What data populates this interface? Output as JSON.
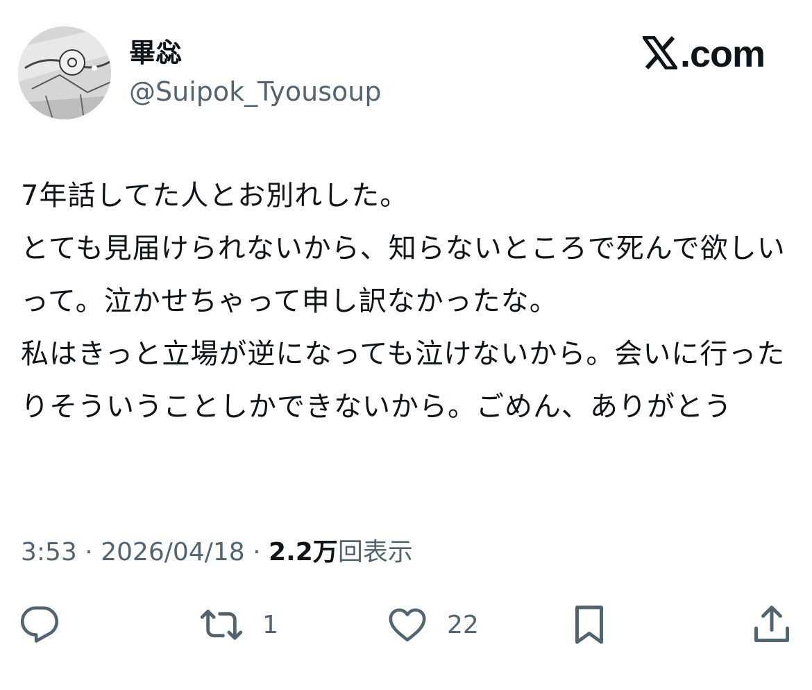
{
  "post": {
    "author": {
      "display_name": "畢惢",
      "handle": "@Suipok_Tyousoup"
    },
    "brand": {
      "text": ".com",
      "icon": "x-logo-icon"
    },
    "text": "7年話してた人とお別れした。\nとても見届けられないから、知らないところで死んで欲しいって。泣かせちゃって申し訳なかったな。\n私はきっと立場が逆になっても泣けないから。会いに行ったりそういうことしかできないから。ごめん、ありがとう",
    "meta": {
      "time": "3:53",
      "separator": " · ",
      "date": "2026/04/18",
      "views_count": "2.2万",
      "views_label": "回表示"
    },
    "actions": {
      "reply": {
        "icon": "reply-icon",
        "count": ""
      },
      "repost": {
        "icon": "repost-icon",
        "count": "1"
      },
      "like": {
        "icon": "heart-icon",
        "count": "22"
      },
      "bookmark": {
        "icon": "bookmark-icon",
        "count": ""
      },
      "share": {
        "icon": "share-icon",
        "count": ""
      }
    }
  },
  "colors": {
    "text_primary": "#0f1419",
    "text_secondary": "#536471",
    "background": "#ffffff"
  }
}
